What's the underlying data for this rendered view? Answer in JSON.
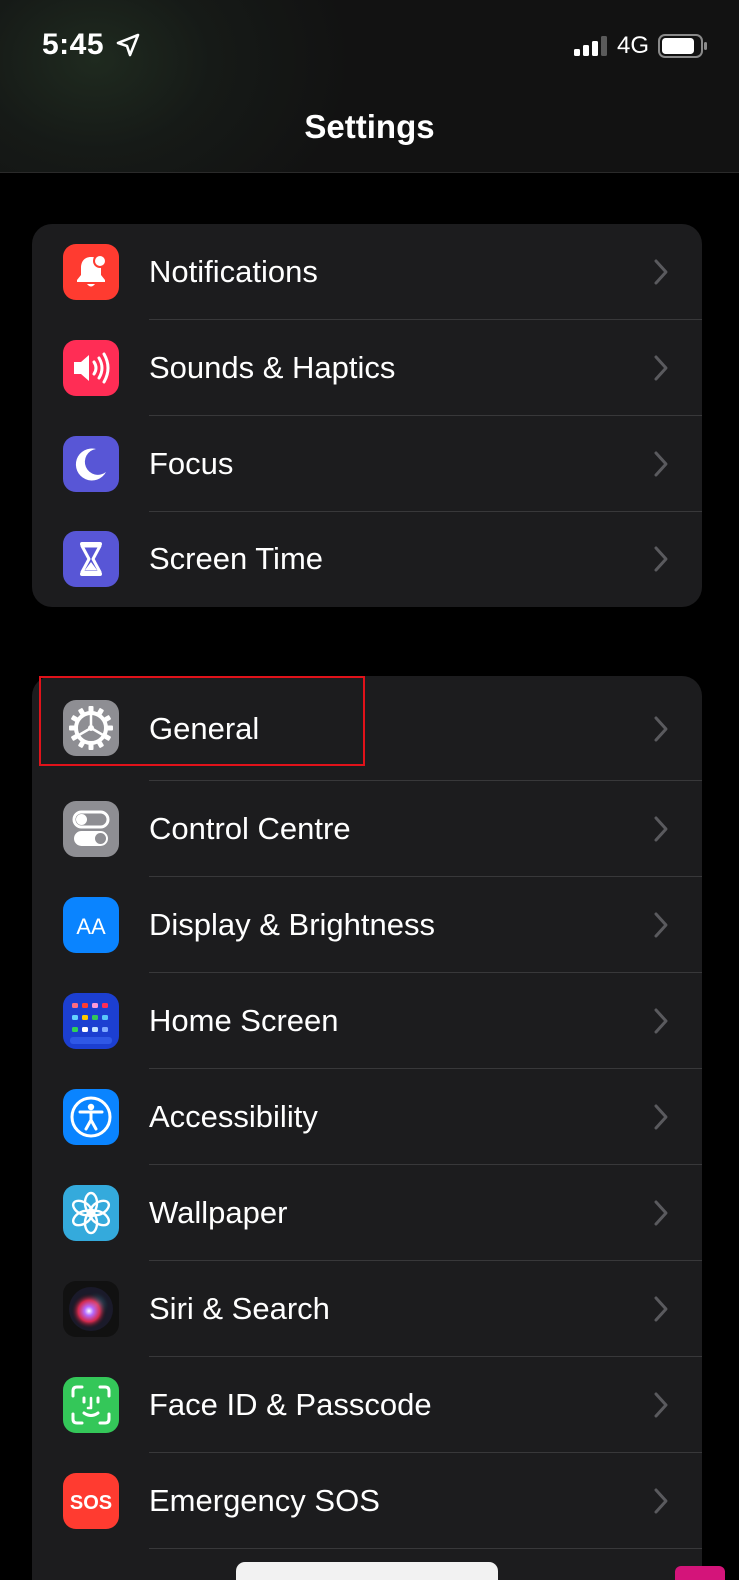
{
  "status_bar": {
    "time": "5:45",
    "network": "4G",
    "location_icon": "location-arrow-icon",
    "signal_icon": "cellular-signal-icon",
    "battery_icon": "battery-icon"
  },
  "nav": {
    "title": "Settings"
  },
  "groups": [
    {
      "items": [
        {
          "label": "Notifications",
          "icon": "notifications-icon",
          "color": "#ff3b30"
        },
        {
          "label": "Sounds & Haptics",
          "icon": "speaker-icon",
          "color": "#ff2d55"
        },
        {
          "label": "Focus",
          "icon": "moon-icon",
          "color": "#5856d6"
        },
        {
          "label": "Screen Time",
          "icon": "hourglass-icon",
          "color": "#5856d6"
        }
      ]
    },
    {
      "items": [
        {
          "label": "General",
          "icon": "gear-icon",
          "color": "#8e8e93"
        },
        {
          "label": "Control Centre",
          "icon": "toggles-icon",
          "color": "#8e8e93"
        },
        {
          "label": "Display & Brightness",
          "icon": "text-size-icon",
          "color": "#0a84ff",
          "glyph": "AA"
        },
        {
          "label": "Home Screen",
          "icon": "home-screen-grid-icon",
          "color": "#1c3fd1"
        },
        {
          "label": "Accessibility",
          "icon": "accessibility-icon",
          "color": "#0a84ff"
        },
        {
          "label": "Wallpaper",
          "icon": "flower-icon",
          "color": "#34aadc"
        },
        {
          "label": "Siri & Search",
          "icon": "siri-icon",
          "color": "#111111"
        },
        {
          "label": "Face ID & Passcode",
          "icon": "face-id-icon",
          "color": "#34c759"
        },
        {
          "label": "Emergency SOS",
          "icon": "sos-icon",
          "color": "#ff3b30",
          "glyph": "SOS"
        }
      ]
    }
  ],
  "highlight": {
    "target": "General",
    "color": "#e0121a"
  }
}
